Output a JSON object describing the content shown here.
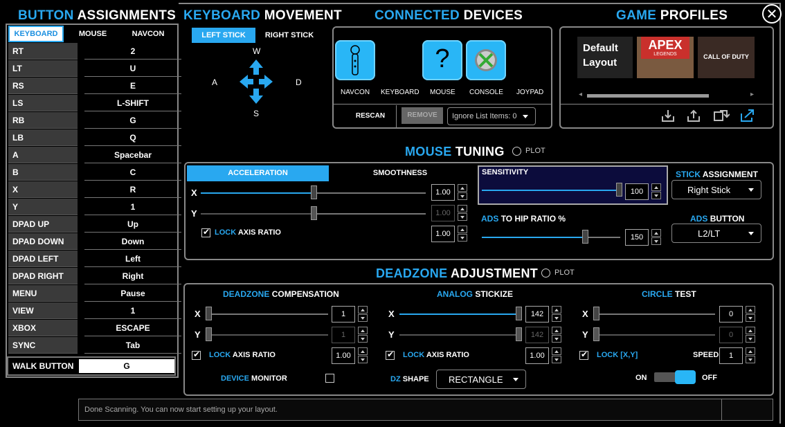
{
  "button_assignments": {
    "title_a": "BUTTON",
    "title_b": "ASSIGNMENTS",
    "tabs": [
      "KEYBOARD",
      "MOUSE",
      "NAVCON"
    ],
    "rows": [
      {
        "key": "RT",
        "value": "2"
      },
      {
        "key": "LT",
        "value": "U"
      },
      {
        "key": "RS",
        "value": "E"
      },
      {
        "key": "LS",
        "value": "L-SHIFT"
      },
      {
        "key": "RB",
        "value": "G"
      },
      {
        "key": "LB",
        "value": "Q"
      },
      {
        "key": "A",
        "value": "Spacebar"
      },
      {
        "key": "B",
        "value": "C"
      },
      {
        "key": "X",
        "value": "R"
      },
      {
        "key": "Y",
        "value": "1"
      },
      {
        "key": "DPAD UP",
        "value": "Up"
      },
      {
        "key": "DPAD DOWN",
        "value": "Down"
      },
      {
        "key": "DPAD LEFT",
        "value": "Left"
      },
      {
        "key": "DPAD RIGHT",
        "value": "Right"
      },
      {
        "key": "MENU",
        "value": "Pause"
      },
      {
        "key": "VIEW",
        "value": "1"
      },
      {
        "key": "XBOX",
        "value": "ESCAPE"
      },
      {
        "key": "SYNC",
        "value": "Tab"
      }
    ],
    "walk_key": "WALK BUTTON",
    "walk_value": "G"
  },
  "keyboard_movement": {
    "title_a": "KEYBOARD",
    "title_b": "MOVEMENT",
    "tabs": [
      "LEFT STICK",
      "RIGHT STICK"
    ],
    "w": "W",
    "a": "A",
    "s": "S",
    "d": "D"
  },
  "connected_devices": {
    "title_a": "CONNECTED",
    "title_b": "DEVICES",
    "labels": [
      "NAVCON",
      "KEYBOARD",
      "MOUSE",
      "CONSOLE",
      "JOYPAD"
    ],
    "mouse_glyph": "?",
    "rescan": "RESCAN",
    "remove": "REMOVE",
    "ignore_list": "Ignore List Items: 0"
  },
  "game_profiles": {
    "title_a": "GAME",
    "title_b": "PROFILES",
    "default_layout": "Default Layout",
    "apex_title": "APEX",
    "apex_sub": "LEGENDS",
    "cod_title": "CALL OF DUTY"
  },
  "mouse_tuning": {
    "title_a": "MOUSE",
    "title_b": "TUNING",
    "plot": "PLOT",
    "tabs": [
      "ACCELERATION",
      "SMOOTHNESS"
    ],
    "x_label": "X",
    "y_label": "Y",
    "x_value": "1.00",
    "y_value": "1.00",
    "ratio_value": "1.00",
    "lock_a": "LOCK",
    "lock_b": "AXIS RATIO",
    "sensitivity_label": "SENSITIVITY",
    "sensitivity_value": "100",
    "ads_a": "ADS",
    "ads_b": "TO HIP RATIO %",
    "ads_value": "150",
    "stick_a": "STICK",
    "stick_b": "ASSIGNMENT",
    "stick_value": "Right Stick",
    "adsbtn_a": "ADS",
    "adsbtn_b": "BUTTON",
    "adsbtn_value": "L2/LT",
    "x_level": 0.5,
    "y_level": 0.5,
    "sensitivity_level": 1.0,
    "ads_level": 0.75
  },
  "deadzone": {
    "title_a": "DEADZONE",
    "title_b": "ADJUSTMENT",
    "plot": "PLOT",
    "comp_a": "DEADZONE",
    "comp_b": "COMPENSATION",
    "stick_a": "ANALOG",
    "stick_b": "STICKIZE",
    "circle_a": "CIRCLE",
    "circle_b": "TEST",
    "x": "X",
    "y": "Y",
    "comp_x": "1",
    "comp_y": "1",
    "comp_ratio": "1.00",
    "stick_x": "142",
    "stick_y": "142",
    "stick_ratio": "1.00",
    "circle_x": "0",
    "circle_y": "0",
    "lock_a": "LOCK",
    "lock_b": "AXIS RATIO",
    "lockxy_a": "LOCK",
    "lockxy_b": "[X,Y]",
    "speed_label": "SPEED",
    "speed_value": "1",
    "monitor_a": "DEVICE",
    "monitor_b": "MONITOR",
    "shape_a": "DZ",
    "shape_b": "SHAPE",
    "shape_value": "RECTANGLE",
    "on": "ON",
    "off": "OFF"
  },
  "status": {
    "text": "Done Scanning. You can now start setting up your layout."
  }
}
